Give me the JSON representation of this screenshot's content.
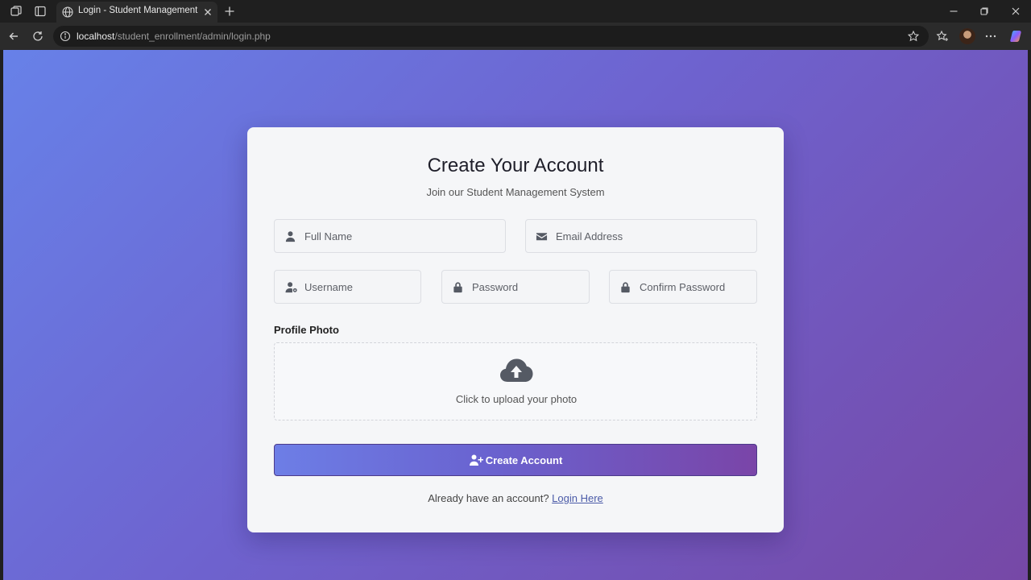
{
  "browser": {
    "tab_title": "Login - Student Management System",
    "url_host": "localhost",
    "url_path": "/student_enrollment/admin/login.php"
  },
  "page": {
    "title": "Create Your Account",
    "subtitle": "Join our Student Management System",
    "fields": {
      "full_name": "Full Name",
      "email": "Email Address",
      "username": "Username",
      "password": "Password",
      "confirm_password": "Confirm Password"
    },
    "profile_photo_label": "Profile Photo",
    "upload_text": "Click to upload your photo",
    "create_button": "Create Account",
    "login_prompt": "Already have an account?",
    "login_link": "Login Here"
  },
  "colors": {
    "background_start": "#6781e8",
    "background_end": "#7648a6",
    "card": "#f5f6f8",
    "button_start": "#6d7ee6",
    "button_end": "#7a45a8"
  }
}
